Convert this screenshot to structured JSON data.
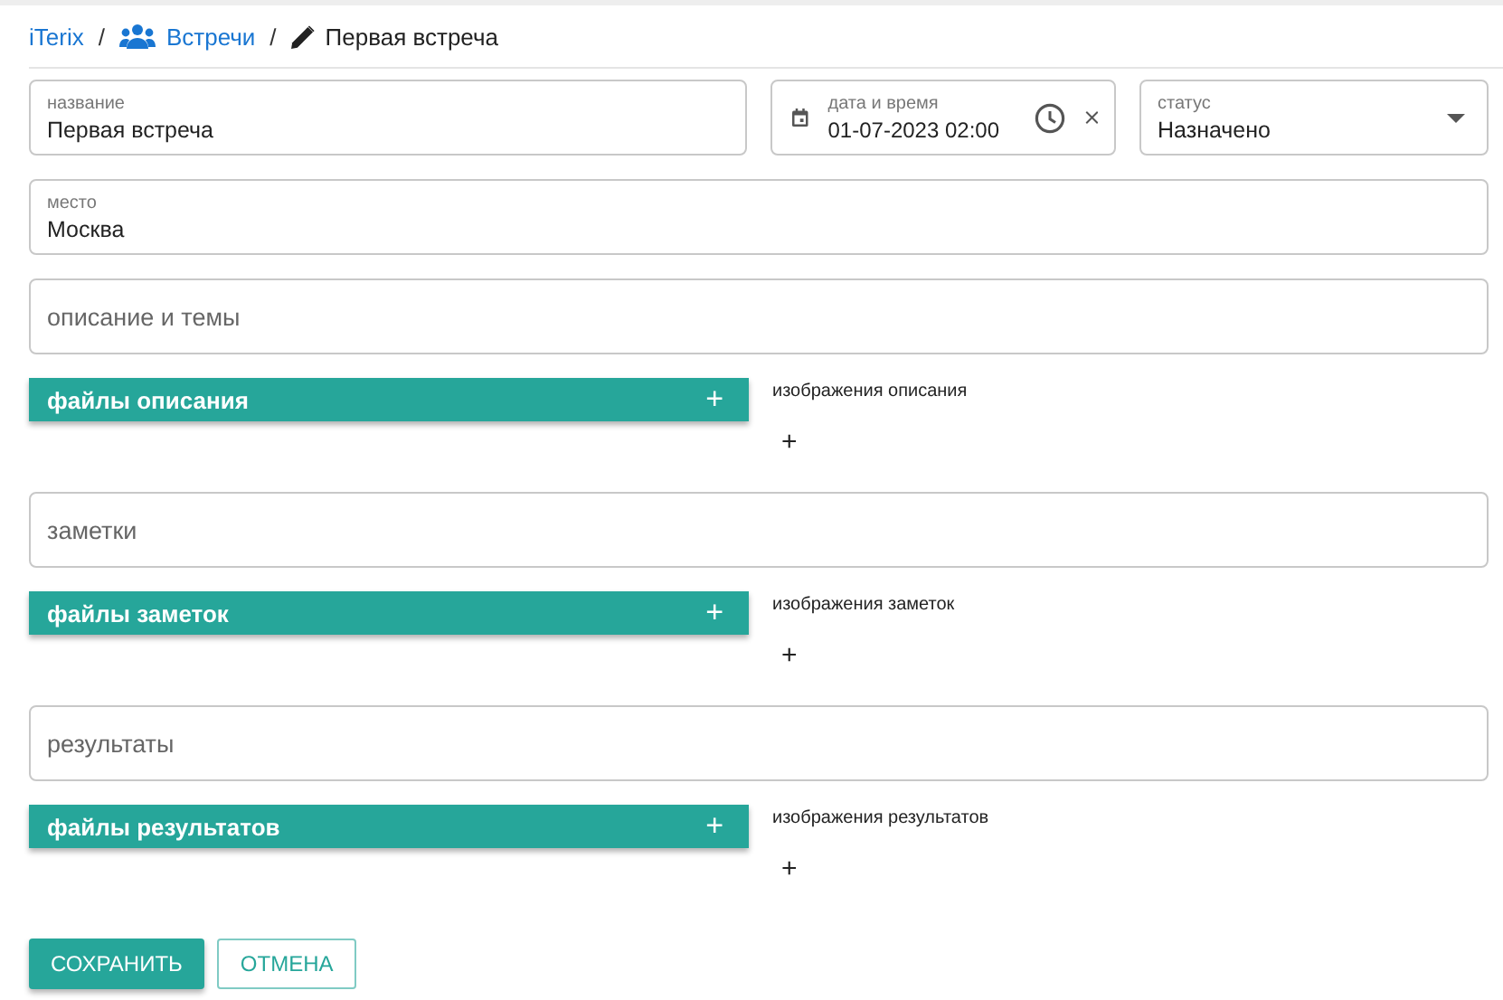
{
  "breadcrumb": {
    "separator": "/",
    "items": [
      {
        "text": "iTerix",
        "kind": "link"
      },
      {
        "text": "Встречи",
        "kind": "group"
      },
      {
        "text": "Первая встреча",
        "kind": "edit"
      }
    ]
  },
  "name_field": {
    "label": "название",
    "value": "Первая встреча"
  },
  "datetime_field": {
    "label": "дата и время",
    "value": "01-07-2023 02:00"
  },
  "status_field": {
    "label": "статус",
    "value": "Назначено"
  },
  "place_field": {
    "label": "место",
    "value": "Москва"
  },
  "sections": [
    {
      "placeholder": "описание и темы",
      "files_title": "файлы описания",
      "files_add": "+",
      "images_label": "изображения описания",
      "images_add": "+"
    },
    {
      "placeholder": "заметки",
      "files_title": "файлы заметок",
      "files_add": "+",
      "images_label": "изображения заметок",
      "images_add": "+"
    },
    {
      "placeholder": "результаты",
      "files_title": "файлы результатов",
      "files_add": "+",
      "images_label": "изображения результатов",
      "images_add": "+"
    }
  ],
  "buttons": [
    {
      "label": "СОХРАНИТЬ",
      "kind": "primary"
    },
    {
      "label": "ОТМЕНА",
      "kind": "outline"
    }
  ]
}
